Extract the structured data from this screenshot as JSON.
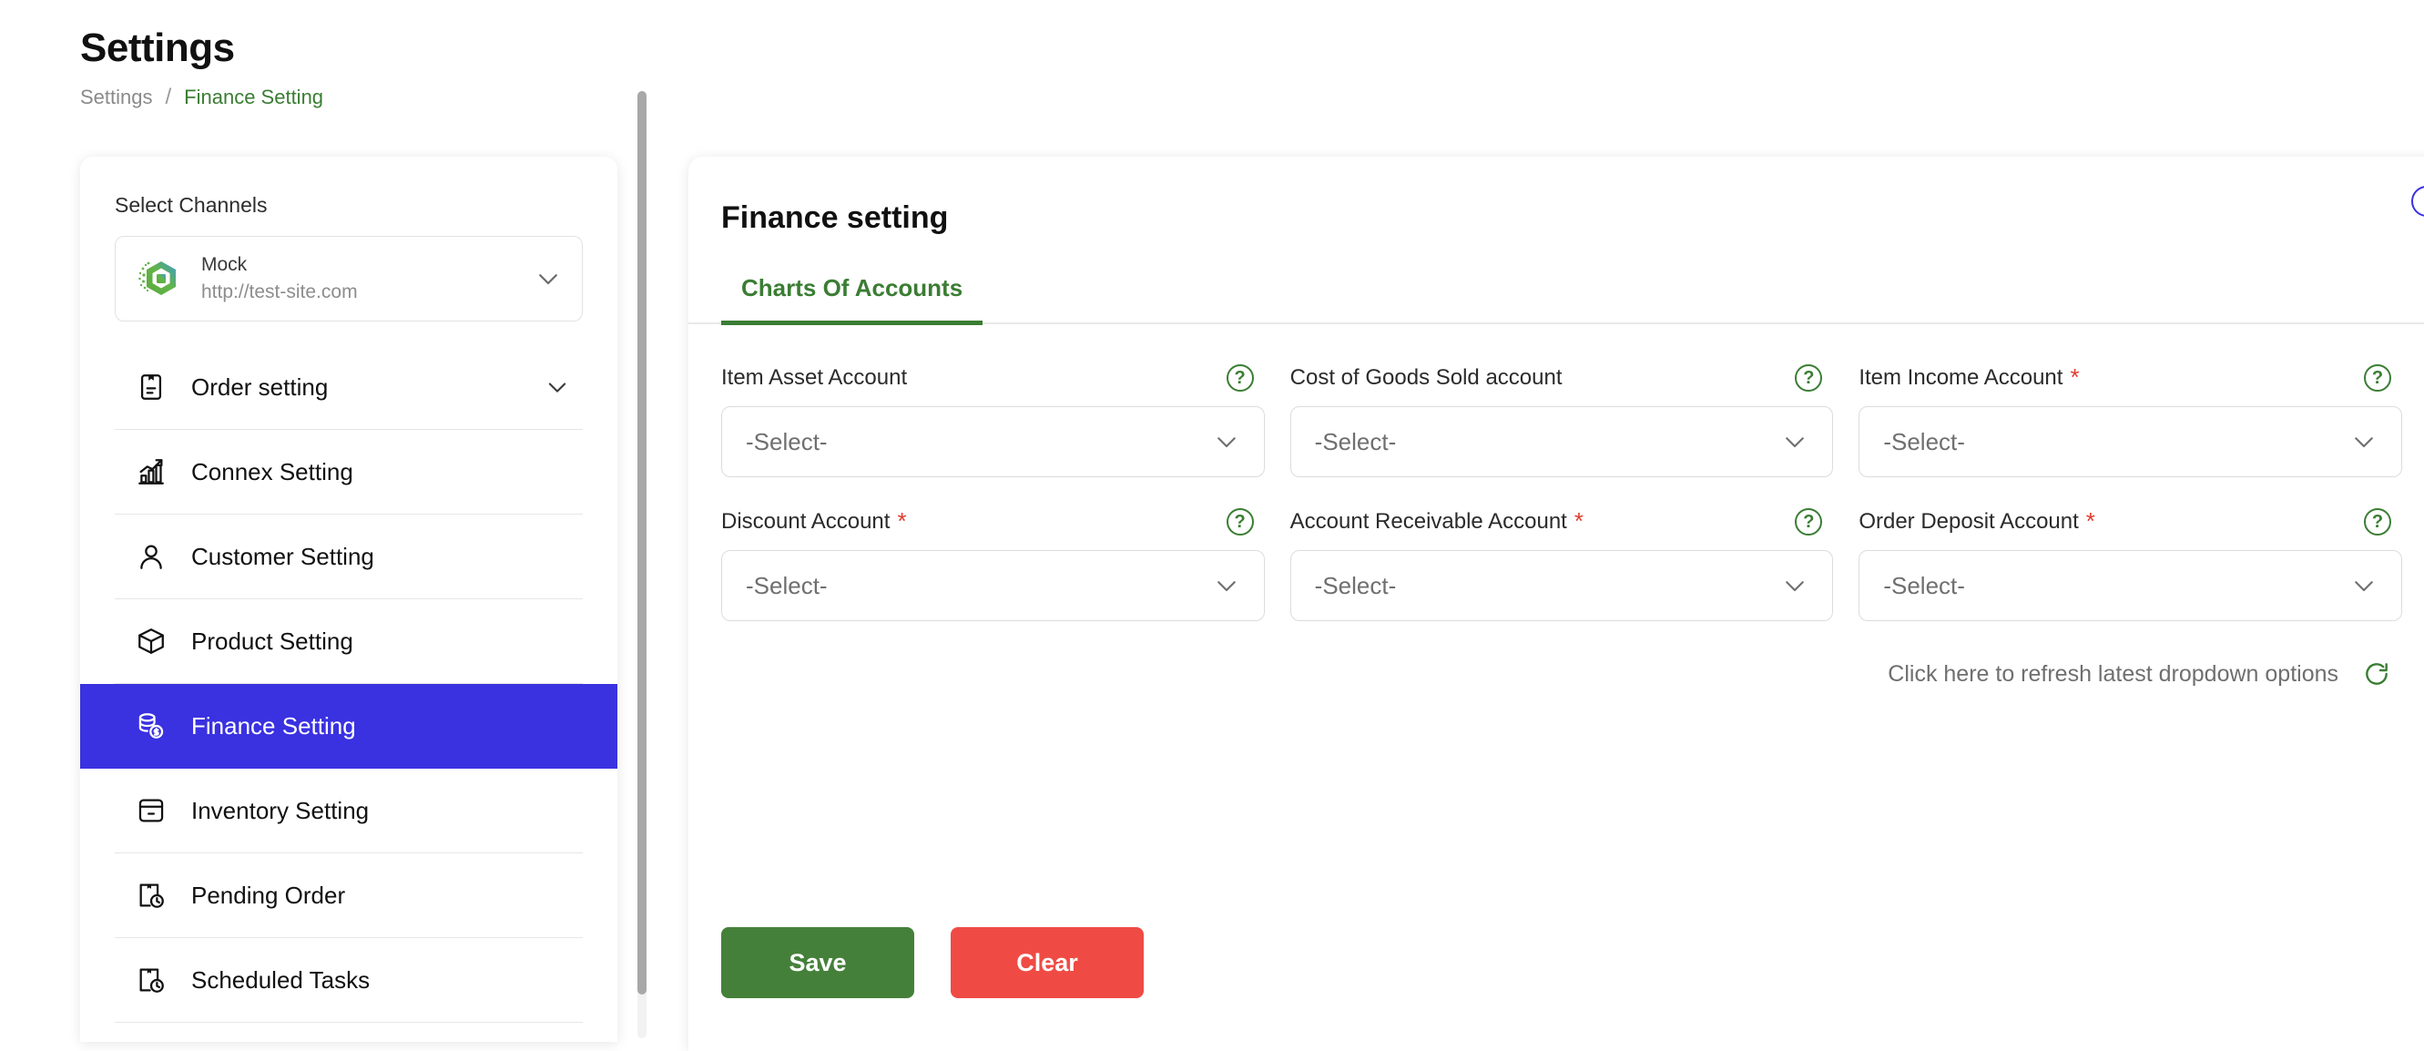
{
  "header": {
    "title": "Settings",
    "breadcrumb": {
      "parent": "Settings",
      "separator": "/",
      "current": "Finance Setting"
    }
  },
  "sidebar": {
    "channels_label": "Select Channels",
    "channel": {
      "name": "Mock",
      "url": "http://test-site.com",
      "logo_icon": "hexagon-cube-logo",
      "chevron_icon": "chevron-down-icon"
    },
    "items": [
      {
        "label": "Order setting",
        "icon": "clipboard-icon",
        "active": false,
        "has_chevron": true
      },
      {
        "label": "Connex Setting",
        "icon": "bar-chart-up-icon",
        "active": false,
        "has_chevron": false
      },
      {
        "label": "Customer Setting",
        "icon": "user-icon",
        "active": false,
        "has_chevron": false
      },
      {
        "label": "Product Setting",
        "icon": "box-icon",
        "active": false,
        "has_chevron": false
      },
      {
        "label": "Finance Setting",
        "icon": "coins-dollar-icon",
        "active": true,
        "has_chevron": false
      },
      {
        "label": "Inventory Setting",
        "icon": "archive-box-icon",
        "active": false,
        "has_chevron": false
      },
      {
        "label": "Pending Order",
        "icon": "box-clock-icon",
        "active": false,
        "has_chevron": false
      },
      {
        "label": "Scheduled Tasks",
        "icon": "box-clock-icon",
        "active": false,
        "has_chevron": false
      }
    ]
  },
  "main": {
    "title": "Finance setting",
    "info_badge": "i",
    "tabs": [
      {
        "label": "Charts Of Accounts",
        "active": true
      }
    ],
    "fields": [
      {
        "label": "Item Asset Account",
        "required": false,
        "value": "-Select-",
        "help_icon": "question-icon"
      },
      {
        "label": "Cost of Goods Sold account",
        "required": false,
        "value": "-Select-",
        "help_icon": "question-icon"
      },
      {
        "label": "Item Income Account",
        "required": true,
        "value": "-Select-",
        "help_icon": "question-icon"
      },
      {
        "label": "Discount Account",
        "required": true,
        "value": "-Select-",
        "help_icon": "question-icon"
      },
      {
        "label": "Account Receivable Account",
        "required": true,
        "value": "-Select-",
        "help_icon": "question-icon"
      },
      {
        "label": "Order Deposit Account",
        "required": true,
        "value": "-Select-",
        "help_icon": "question-icon"
      }
    ],
    "required_marker": "*",
    "refresh": {
      "text": "Click here to refresh latest dropdown options",
      "icon": "refresh-icon"
    },
    "buttons": {
      "save": "Save",
      "clear": "Clear"
    }
  },
  "colors": {
    "accent_green": "#3a7d33",
    "active_menu": "#3a31e0",
    "save_green": "#45803a",
    "clear_red": "#ef4b44",
    "required_red": "#e23b2e"
  }
}
